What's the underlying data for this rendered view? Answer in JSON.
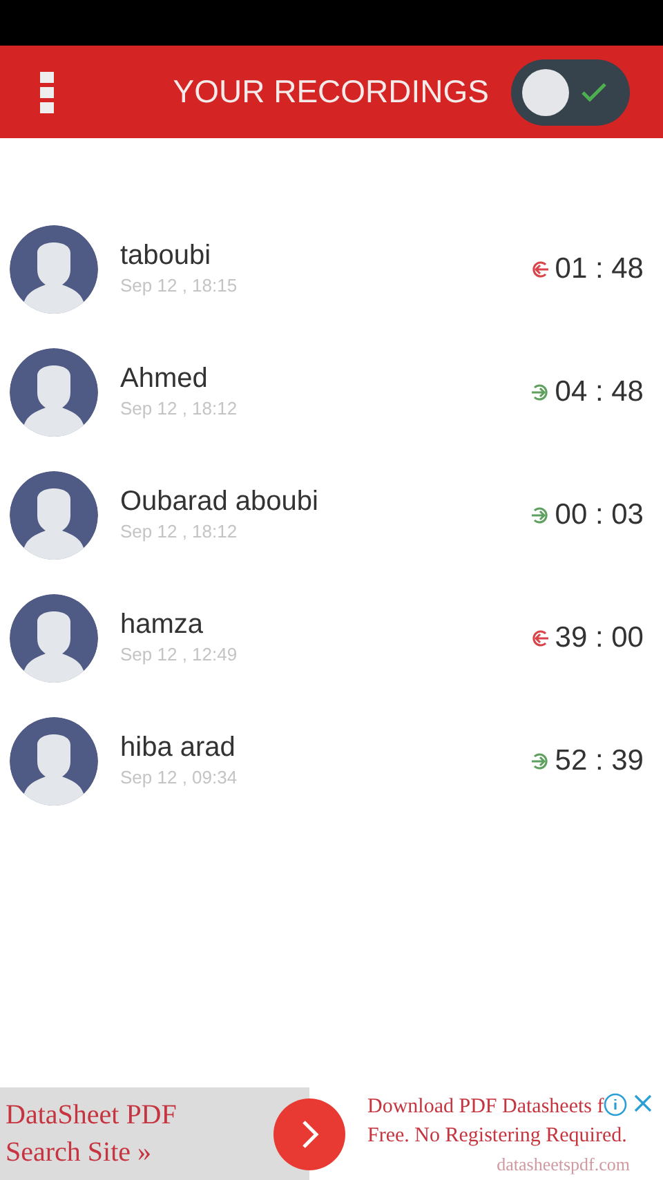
{
  "header": {
    "title": "YOUR RECORDINGS",
    "toggle": {
      "on": true
    }
  },
  "recordings": [
    {
      "name": "taboubi",
      "date": "Sep 12 , 18:15",
      "duration": "01 : 48",
      "kind": "incoming"
    },
    {
      "name": "Ahmed",
      "date": "Sep 12 , 18:12",
      "duration": "04 : 48",
      "kind": "outgoing"
    },
    {
      "name": "Oubarad aboubi",
      "date": "Sep 12 , 18:12",
      "duration": "00 : 03",
      "kind": "outgoing"
    },
    {
      "name": "hamza",
      "date": "Sep 12 , 12:49",
      "duration": "39 : 00",
      "kind": "incoming"
    },
    {
      "name": "hiba arad",
      "date": "Sep 12 , 09:34",
      "duration": "52 : 39",
      "kind": "outgoing"
    }
  ],
  "ad": {
    "headline": "DataSheet PDF Search Site »",
    "text": "Download PDF Datasheets f",
    "text_2": "Free. No Registering Required.",
    "url": "datasheetspdf.com"
  }
}
